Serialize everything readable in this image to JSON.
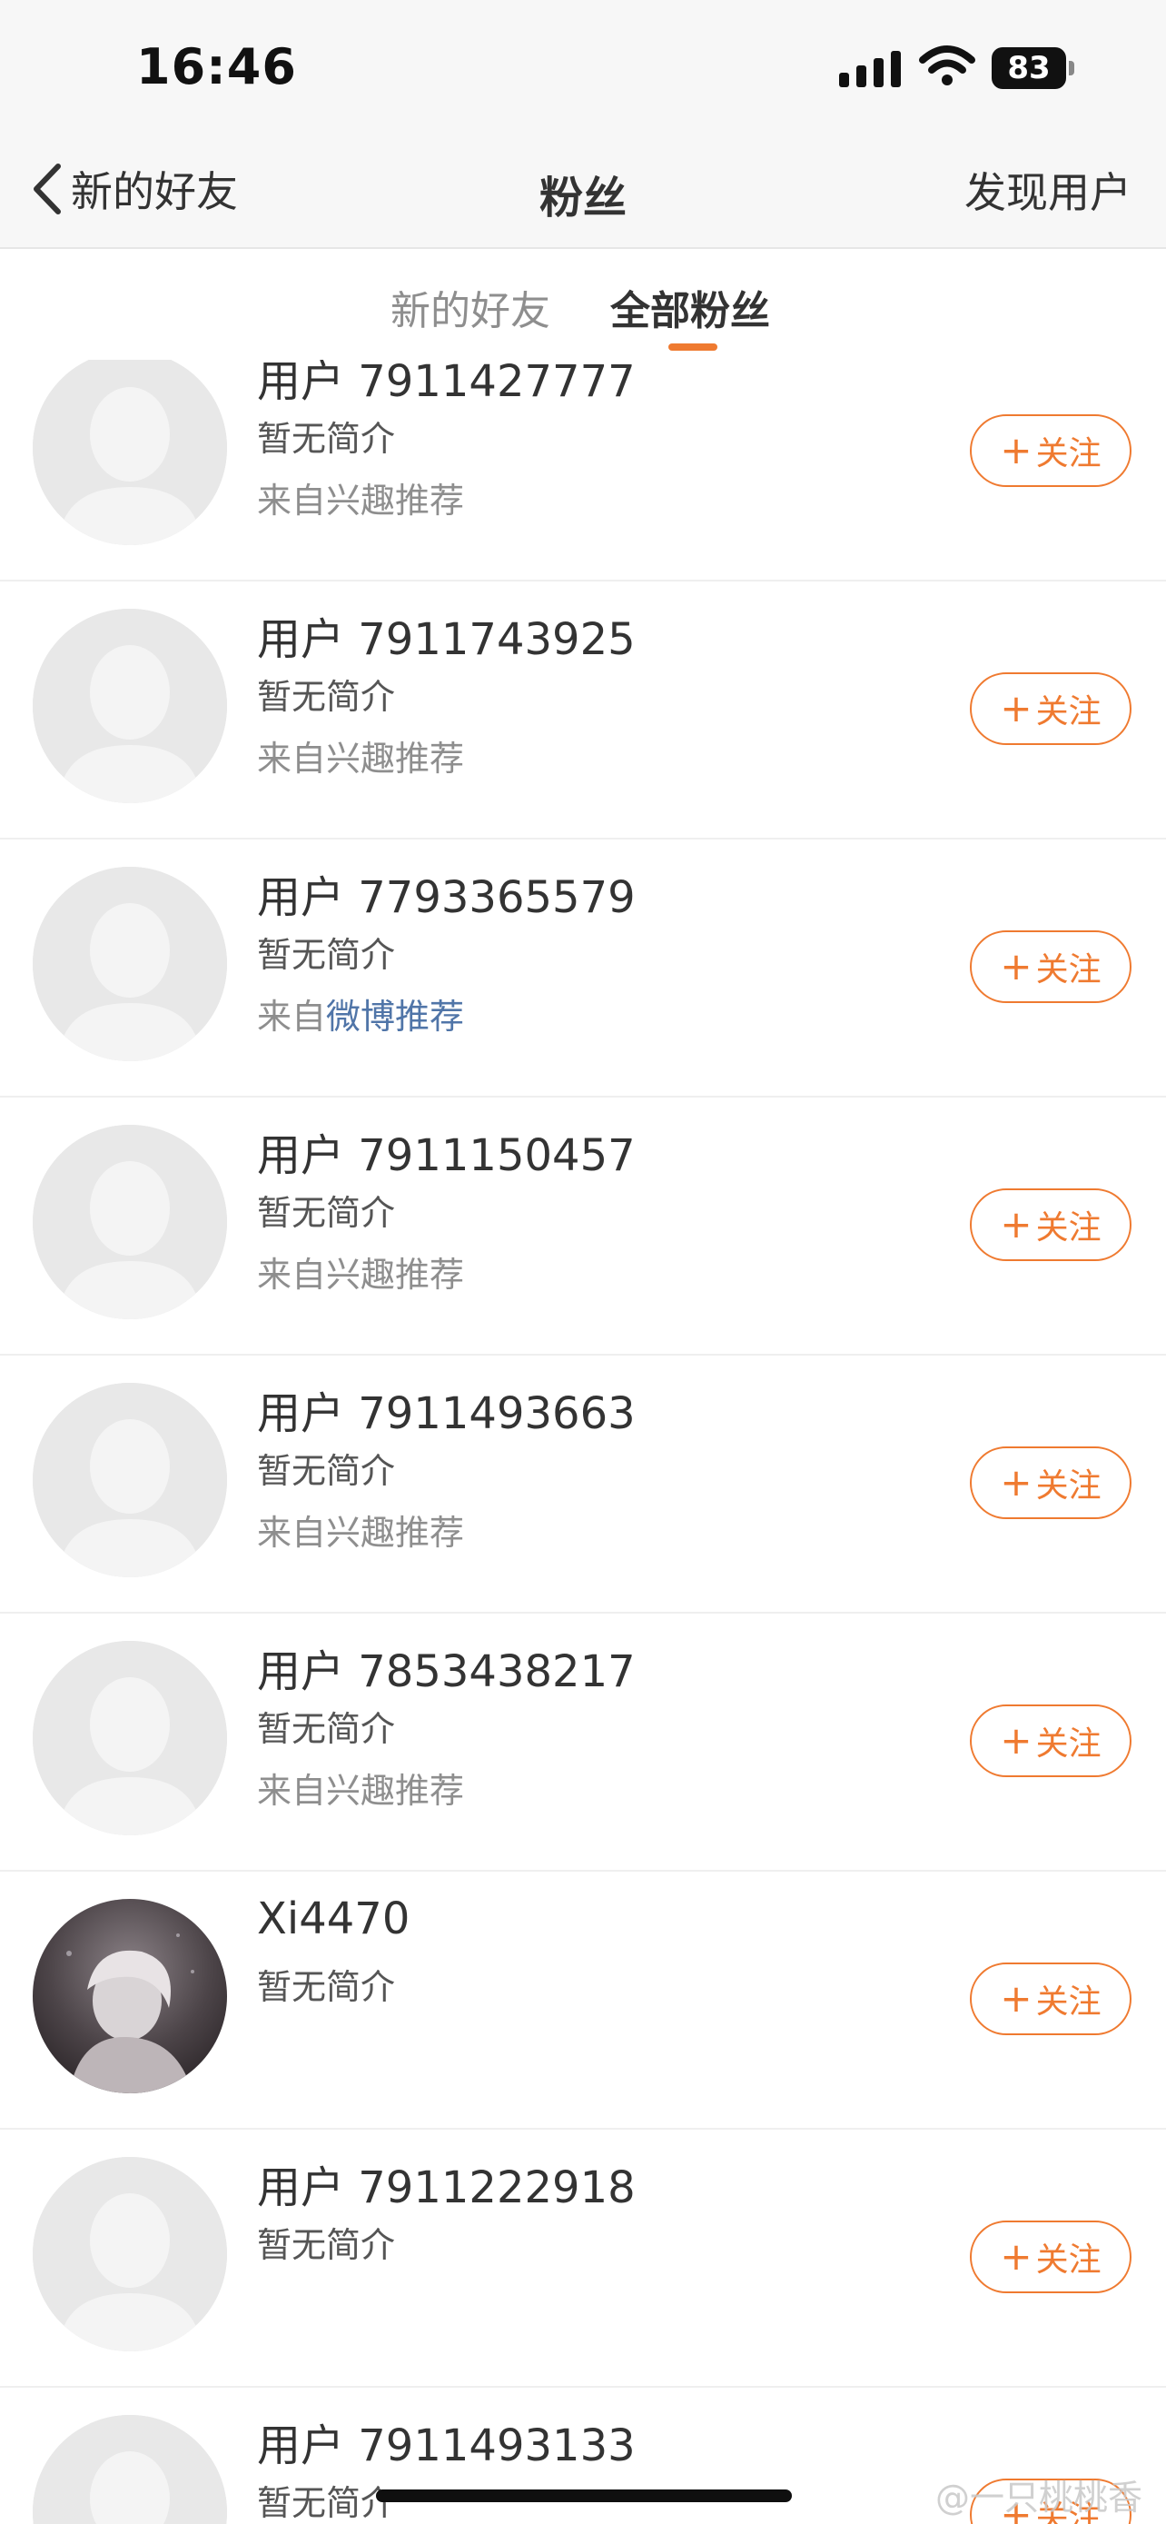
{
  "status_bar": {
    "time": "16:46",
    "battery": "83"
  },
  "nav": {
    "back_label": "新的好友",
    "title": "粉丝",
    "right_action": "发现用户"
  },
  "tabs": [
    {
      "label": "新的好友"
    },
    {
      "label": "全部粉丝"
    }
  ],
  "accent_color": "#ef7a30",
  "link_color": "#5075a8",
  "follow_label": "关注",
  "users": [
    {
      "name": "用户 7911427777",
      "bio": "暂无简介",
      "source": "来自兴趣推荐"
    },
    {
      "name": "用户 7911743925",
      "bio": "暂无简介",
      "source": "来自兴趣推荐"
    },
    {
      "name": "用户 7793365579",
      "bio": "暂无简介",
      "source_prefix": "来自",
      "source_highlight": "微博推荐"
    },
    {
      "name": "用户 7911150457",
      "bio": "暂无简介",
      "source": "来自兴趣推荐"
    },
    {
      "name": "用户 7911493663",
      "bio": "暂无简介",
      "source": "来自兴趣推荐"
    },
    {
      "name": "用户 7853438217",
      "bio": "暂无简介",
      "source": "来自兴趣推荐"
    },
    {
      "name": "Xi4470",
      "bio": "暂无简介"
    },
    {
      "name": "用户 7911222918",
      "bio": "暂无简介"
    },
    {
      "name": "用户 7911493133",
      "bio": "暂无简介"
    }
  ],
  "watermark": "@一只桃桃香"
}
